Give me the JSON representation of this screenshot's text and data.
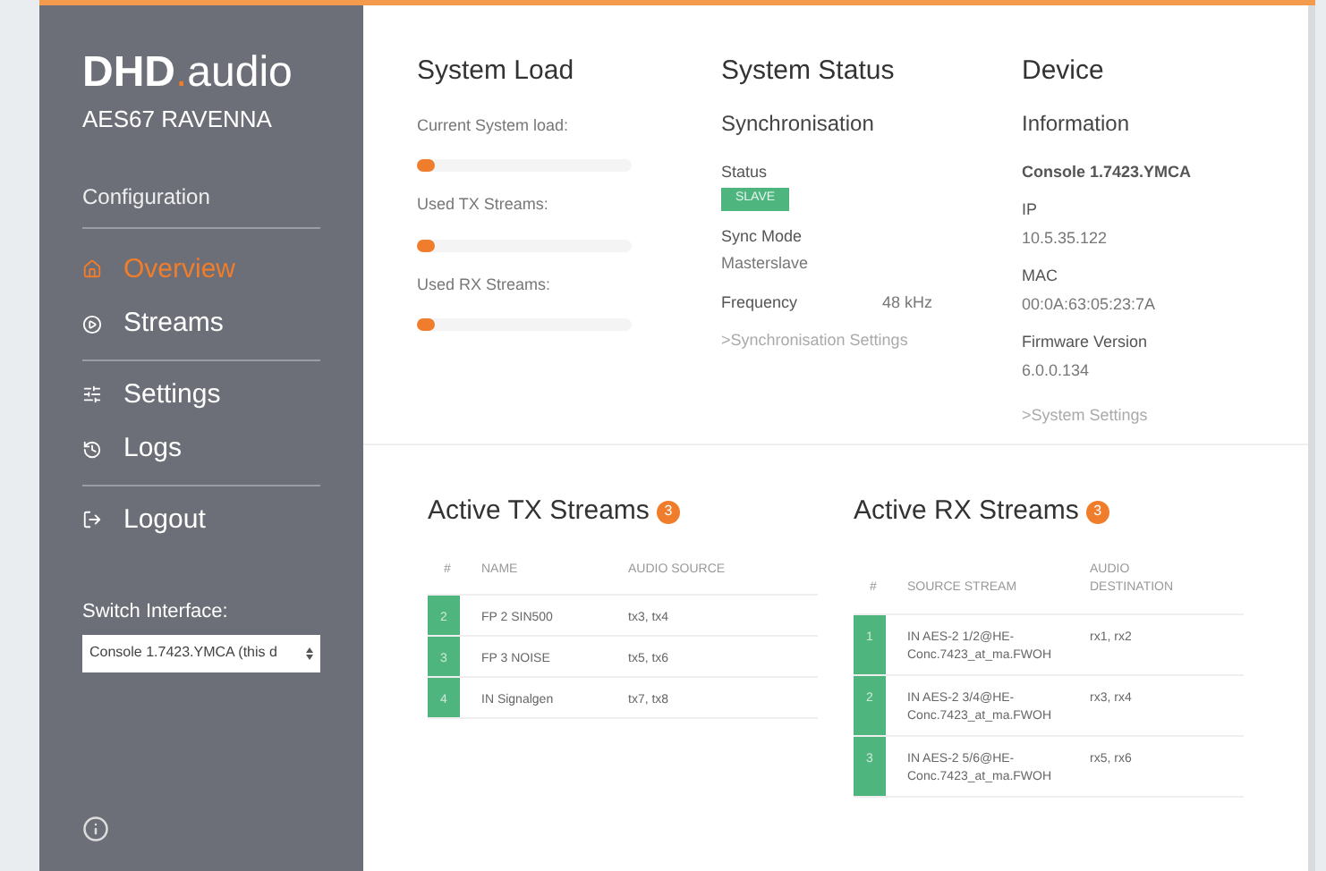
{
  "brand": {
    "name_left": "DHD",
    "dot": ".",
    "name_right": "audio",
    "product": "AES67 RAVENNA"
  },
  "sidebar": {
    "section": "Configuration",
    "items": [
      {
        "label": "Overview",
        "selected": true,
        "divider_after": false
      },
      {
        "label": "Streams",
        "selected": false,
        "divider_after": true
      },
      {
        "label": "Settings",
        "selected": false,
        "divider_after": false
      },
      {
        "label": "Logs",
        "selected": false,
        "divider_after": true
      },
      {
        "label": "Logout",
        "selected": false,
        "divider_after": false
      }
    ],
    "switch_label": "Switch Interface:",
    "switch_value": "Console 1.7423.YMCA (this d"
  },
  "system_load": {
    "title": "System Load",
    "meters": [
      {
        "label": "Current System load:",
        "level": 0.08
      },
      {
        "label": "Used TX Streams:",
        "level": 0.08
      },
      {
        "label": "Used RX Streams:",
        "level": 0.08
      }
    ]
  },
  "system_status": {
    "title": "System Status",
    "subtitle": "Synchronisation",
    "status_label": "Status",
    "status_badge": "SLAVE",
    "sync_mode_label": "Sync Mode",
    "sync_mode": "Masterslave",
    "frequency_label": "Frequency",
    "frequency": "48 kHz",
    "link": ">Synchronisation Settings"
  },
  "device": {
    "title": "Device",
    "subtitle": "Information",
    "name": "Console 1.7423.YMCA",
    "fields": [
      {
        "label": "IP",
        "value": "10.5.35.122"
      },
      {
        "label": "MAC",
        "value": "00:0A:63:05:23:7A"
      },
      {
        "label": "Firmware Version",
        "value": "6.0.0.134"
      }
    ],
    "link": ">System Settings"
  },
  "tx": {
    "title": "Active TX Streams",
    "count": "3",
    "columns": [
      "#",
      "NAME",
      "AUDIO SOURCE"
    ],
    "rows": [
      [
        "2",
        "FP 2 SIN500",
        "tx3, tx4"
      ],
      [
        "3",
        "FP 3 NOISE",
        "tx5, tx6"
      ],
      [
        "4",
        "IN Signalgen",
        "tx7, tx8"
      ]
    ]
  },
  "rx": {
    "title": "Active RX Streams",
    "count": "3",
    "columns": [
      "#",
      "SOURCE STREAM",
      "AUDIO DESTINATION"
    ],
    "rows": [
      [
        "1",
        "IN AES-2 1/2@HE-Conc.7423_at_ma.FWOH",
        "rx1, rx2"
      ],
      [
        "2",
        "IN AES-2 3/4@HE-Conc.7423_at_ma.FWOH",
        "rx3, rx4"
      ],
      [
        "3",
        "IN AES-2 5/6@HE-Conc.7423_at_ma.FWOH",
        "rx5, rx6"
      ]
    ]
  }
}
